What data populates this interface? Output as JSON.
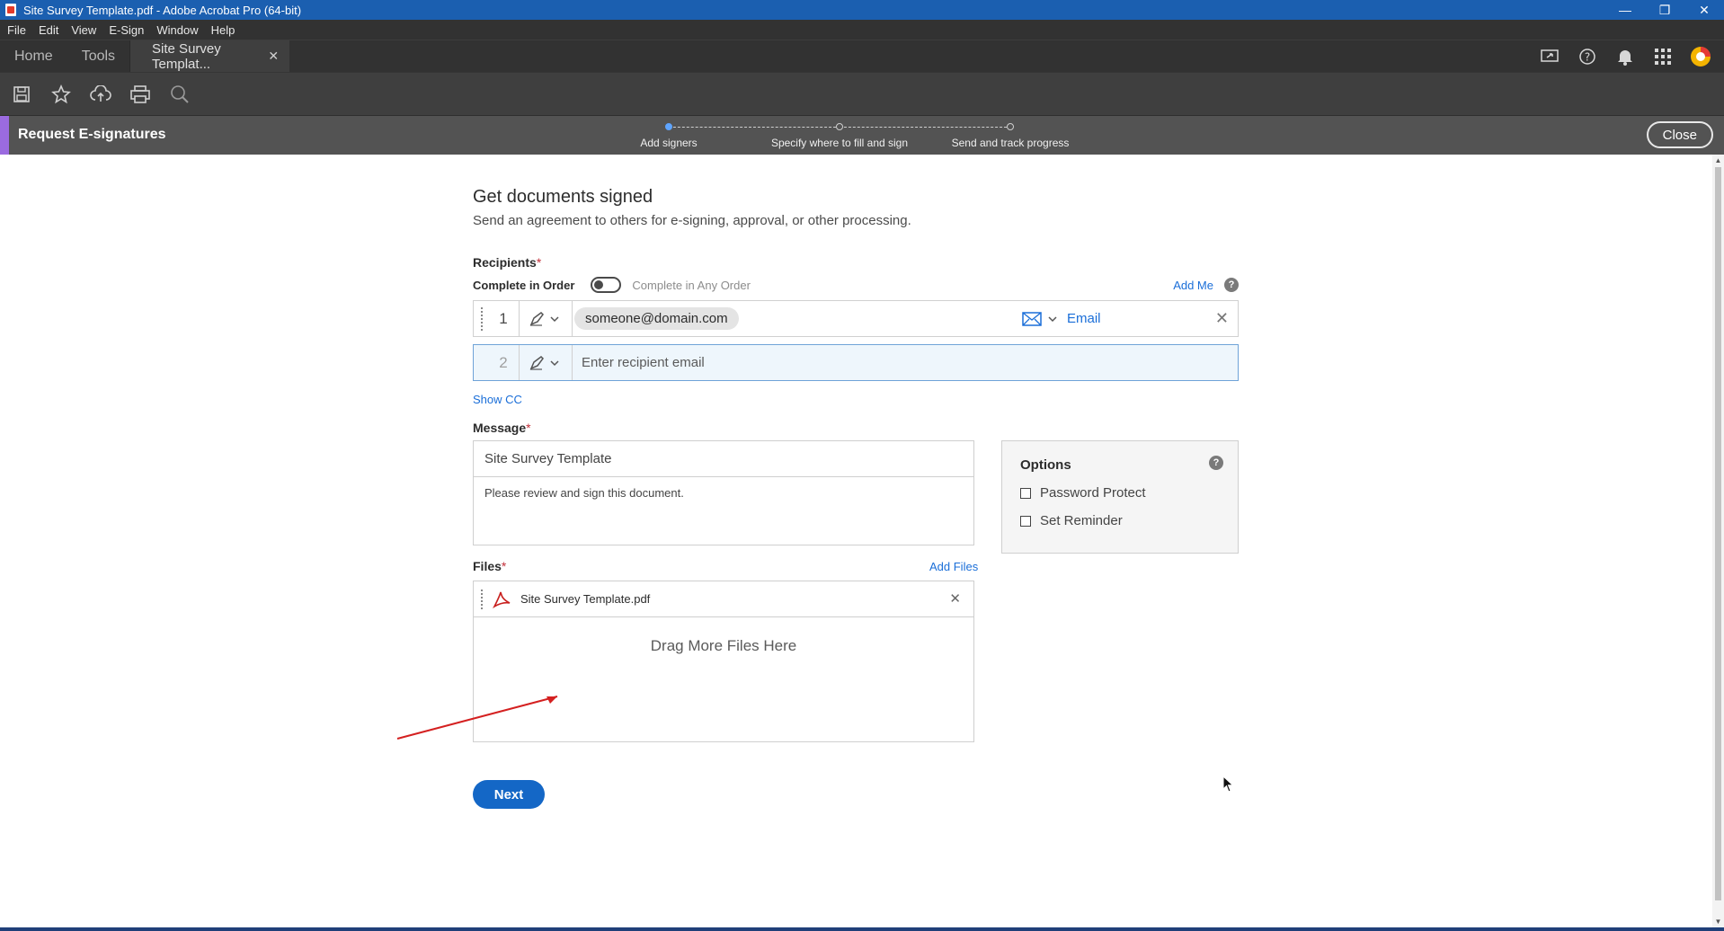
{
  "window": {
    "title": "Site Survey Template.pdf - Adobe Acrobat Pro (64-bit)"
  },
  "menu": [
    "File",
    "Edit",
    "View",
    "E-Sign",
    "Window",
    "Help"
  ],
  "tabs": {
    "home": "Home",
    "tools": "Tools",
    "doc": "Site Survey Templat..."
  },
  "esign": {
    "title": "Request E-signatures",
    "steps": [
      "Add signers",
      "Specify where to fill and sign",
      "Send and track progress"
    ],
    "active_step": 0,
    "close_label": "Close"
  },
  "form": {
    "heading": "Get documents signed",
    "subheading": "Send an agreement to others for e-signing, approval, or other processing.",
    "recipients_label": "Recipients",
    "required_mark": "*",
    "complete_in_order": "Complete in Order",
    "complete_any_order": "Complete in Any Order",
    "add_me": "Add Me",
    "help_glyph": "?",
    "recipients": [
      {
        "index": "1",
        "email": "someone@domain.com",
        "method": "Email"
      },
      {
        "index": "2",
        "placeholder": "Enter recipient email"
      }
    ],
    "show_cc": "Show CC",
    "message_label": "Message",
    "message_title": "Site Survey Template",
    "message_body": "Please review and sign this document.",
    "options_title": "Options",
    "options": [
      "Password Protect",
      "Set Reminder"
    ],
    "files_label": "Files",
    "add_files": "Add Files",
    "file_name": "Site Survey Template.pdf",
    "drag_text": "Drag More Files Here",
    "next_label": "Next"
  },
  "colors": {
    "accent": "#9b6be0",
    "link": "#1a6ed8",
    "primary": "#1467c6",
    "annotation": "#d42020"
  }
}
